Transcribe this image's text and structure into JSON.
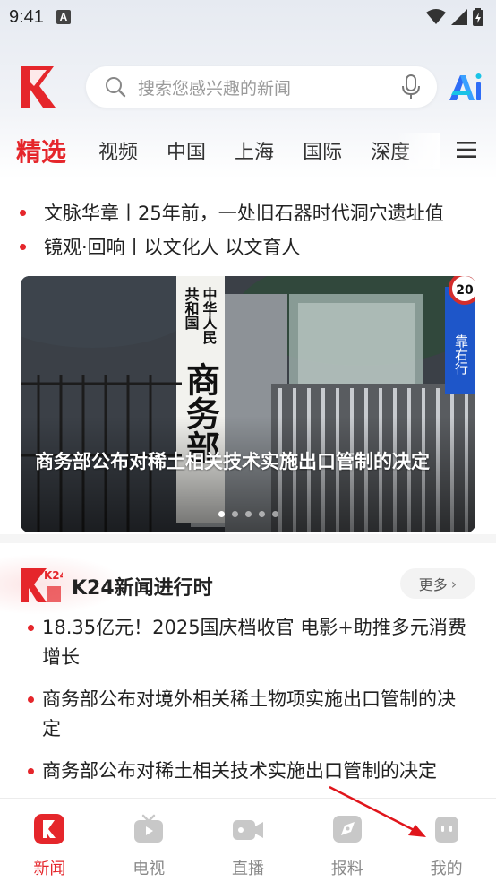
{
  "status_bar": {
    "time": "9:41",
    "notification_letter": "A"
  },
  "search": {
    "placeholder": "搜索您感兴趣的新闻"
  },
  "tabs": [
    {
      "label": "精选",
      "active": true
    },
    {
      "label": "视频"
    },
    {
      "label": "中国"
    },
    {
      "label": "上海"
    },
    {
      "label": "国际"
    },
    {
      "label": "深度"
    }
  ],
  "headlines": [
    "文脉华章丨25年前，一处旧石器时代洞穴遗址值",
    "镜观·回响丨以文化人 以文育人"
  ],
  "carousel": {
    "caption": "商务部公布对稀土相关技术实施出口管制的决定",
    "slide_count": 5,
    "active_index": 0,
    "sign_text": "商务部",
    "sign_small_1": "中华人民",
    "sign_small_2": "共和国",
    "roadsign_text": "靠右行",
    "speed_text": "20"
  },
  "k24": {
    "logo_text": "K24",
    "title": "K24新闻进行时",
    "more_label": "更多",
    "items": [
      "18.35亿元！2025国庆档收官 电影+助推多元消费增长",
      "商务部公布对境外相关稀土物项实施出口管制的决定",
      "商务部公布对稀土相关技术实施出口管制的决定"
    ]
  },
  "bottom_nav": [
    {
      "label": "新闻",
      "icon": "news-icon",
      "active": true
    },
    {
      "label": "电视",
      "icon": "tv-icon"
    },
    {
      "label": "直播",
      "icon": "live-camera-icon"
    },
    {
      "label": "报料",
      "icon": "report-icon"
    },
    {
      "label": "我的",
      "icon": "profile-icon"
    }
  ],
  "colors": {
    "accent": "#e5262b",
    "inactive": "#8a8a8a",
    "icon_inactive": "#c8c8c8"
  }
}
